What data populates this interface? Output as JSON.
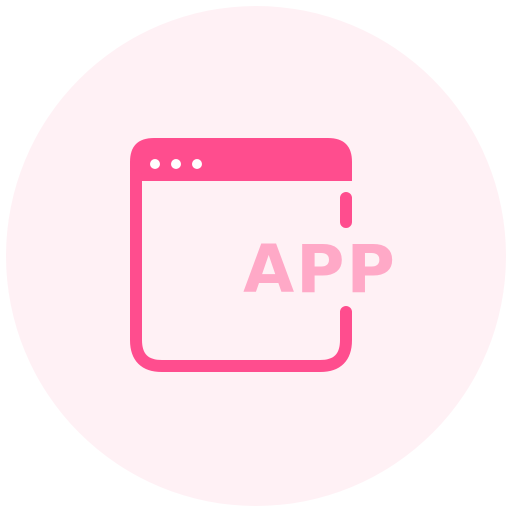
{
  "icon": {
    "name": "app-window-icon",
    "label": "APP",
    "colors": {
      "background_circle": "#fff1f5",
      "frame": "#ff4d8e",
      "header": "#ff4d8e",
      "dots": "#ffffff",
      "label": "#ffa9c7"
    }
  }
}
